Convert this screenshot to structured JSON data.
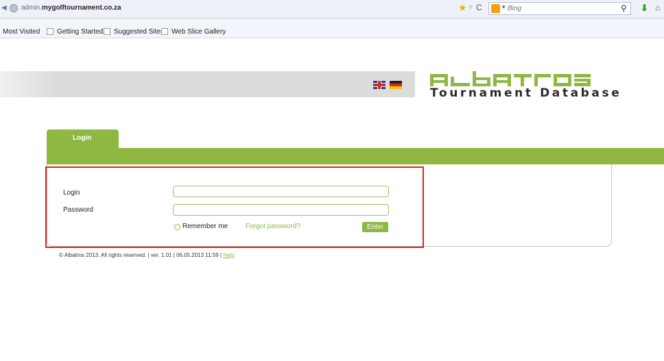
{
  "browser": {
    "url_prefix": "admin.",
    "url_domain": "mygolftournament.co.za",
    "search_placeholder": "Bing",
    "bookmarks": [
      "Most Visited",
      "Getting Started",
      "Suggested Sites",
      "Web Slice Gallery"
    ]
  },
  "header": {
    "logo_wordmark": "albatros",
    "logo_subtitle": "Tournament Database",
    "languages": [
      "English",
      "German"
    ]
  },
  "tabs": [
    {
      "label": "Login",
      "active": true
    }
  ],
  "form": {
    "login_label": "Login",
    "login_value": "",
    "password_label": "Password",
    "password_value": "",
    "remember_label": "Remember me",
    "remember_checked": false,
    "forgot_label": "Forgot password?",
    "enter_label": "Enter"
  },
  "footer": {
    "text": "© Albatros 2013. All rights reserved. | ver. 1.01 | 06.05.2013 11:59 | ",
    "help_label": "Help"
  },
  "colors": {
    "accent_green": "#8fb843",
    "highlight_red": "#e0201e",
    "header_gray": "#dcdcdc"
  }
}
